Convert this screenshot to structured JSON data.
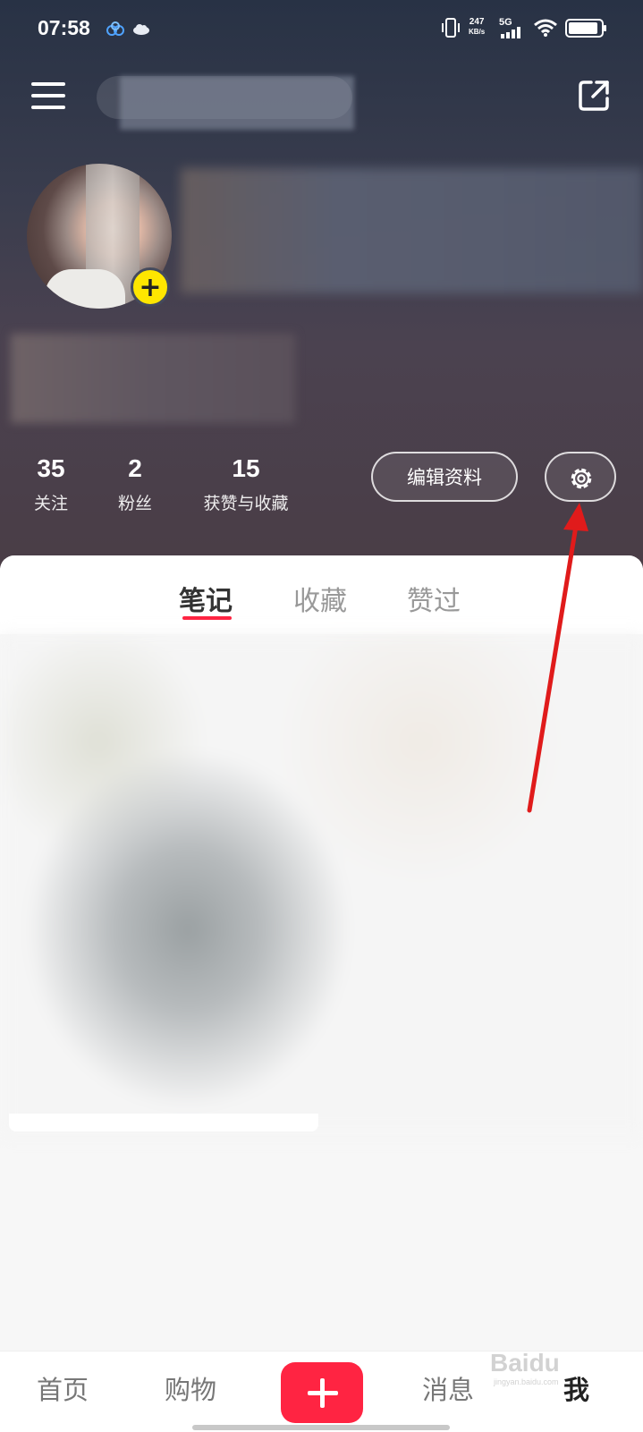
{
  "status_bar": {
    "time": "07:58",
    "net_speed_value": "247",
    "net_speed_unit": "KB/s",
    "network_type": "5G"
  },
  "profile": {
    "stats": [
      {
        "value": "35",
        "label": "关注"
      },
      {
        "value": "2",
        "label": "粉丝"
      },
      {
        "value": "15",
        "label": "获赞与收藏"
      }
    ],
    "edit_button": "编辑资料"
  },
  "tabs": [
    {
      "label": "笔记",
      "active": true
    },
    {
      "label": "收藏",
      "active": false
    },
    {
      "label": "赞过",
      "active": false
    }
  ],
  "bottom_nav": [
    {
      "label": "首页"
    },
    {
      "label": "购物"
    },
    {
      "label": "消息"
    },
    {
      "label": "我",
      "active": true
    }
  ],
  "watermark": {
    "text": "Baidu",
    "sub": "jingyan.baidu.com"
  },
  "colors": {
    "accent": "#ff2442",
    "avatar_badge": "#ffe600",
    "annotation_arrow": "#e01b1b"
  },
  "icons": [
    "menu-icon",
    "share-icon",
    "settings-gear-icon",
    "plus-icon",
    "vibrate-icon",
    "signal-icon",
    "wifi-icon",
    "battery-icon",
    "cloud-icon"
  ]
}
